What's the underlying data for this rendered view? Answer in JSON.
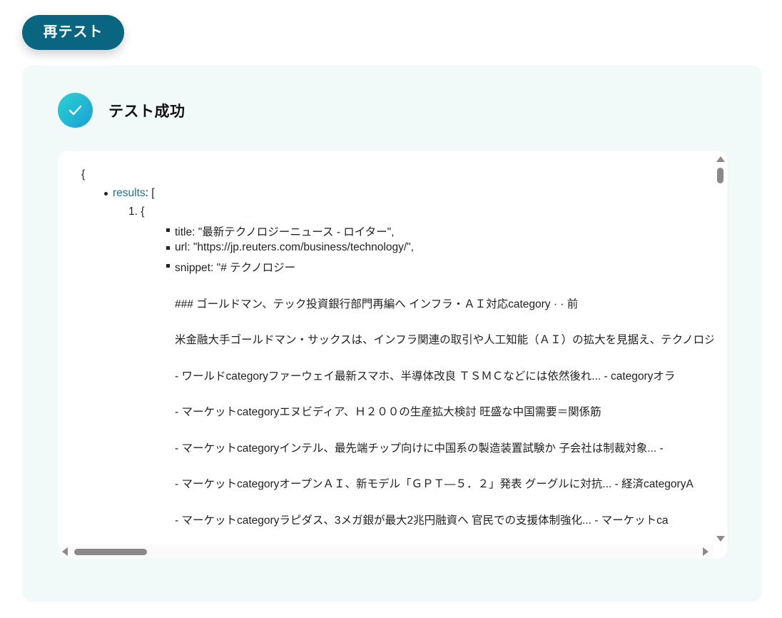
{
  "retest_button": {
    "label": "再テスト"
  },
  "status": {
    "title": "テスト成功",
    "icon": "check-icon"
  },
  "json_viewer": {
    "open_brace": "{",
    "results_key": "results",
    "results_open": ": [",
    "item_index": "1. {",
    "title_line": "title: \"最新テクノロジーニュース - ロイター\",",
    "url_line": "url: \"https://jp.reuters.com/business/technology/\",",
    "snippet_line": "snippet: \"# テクノロジー",
    "snippet_lines": [
      "### ゴールドマン、テック投資銀行部門再編へ インフラ・ＡＩ対応category · · 前",
      "米金融大手ゴールドマン・サックスは、インフラ関連の取引や人工知能（ＡＩ）の拡大を見据え、テクノロジ",
      "- ワールドcategoryファーウェイ最新スマホ、半導体改良 ＴＳＭＣなどには依然後れ... - categoryオラ",
      "- マーケットcategoryエヌビディア、Ｈ２００の生産拡大検討 旺盛な中国需要＝関係筋",
      "- マーケットcategoryインテル、最先端チップ向けに中国系の製造装置試験か 子会社は制裁対象... - ",
      "- マーケットcategoryオープンＡＩ、新モデル「ＧＰＴ―５．２」発表 グーグルに対抗... - 経済categoryA",
      "- マーケットcategoryラピダス、3メガ銀が最大2兆円融資へ 官民での支援体制強化... - マーケットca"
    ]
  },
  "colors": {
    "button_bg": "#0a6581",
    "panel_bg": "#f2faf9",
    "key_color": "#1f6f8b",
    "check_gradient_start": "#2ad3d0",
    "check_gradient_end": "#1b9fd6"
  }
}
